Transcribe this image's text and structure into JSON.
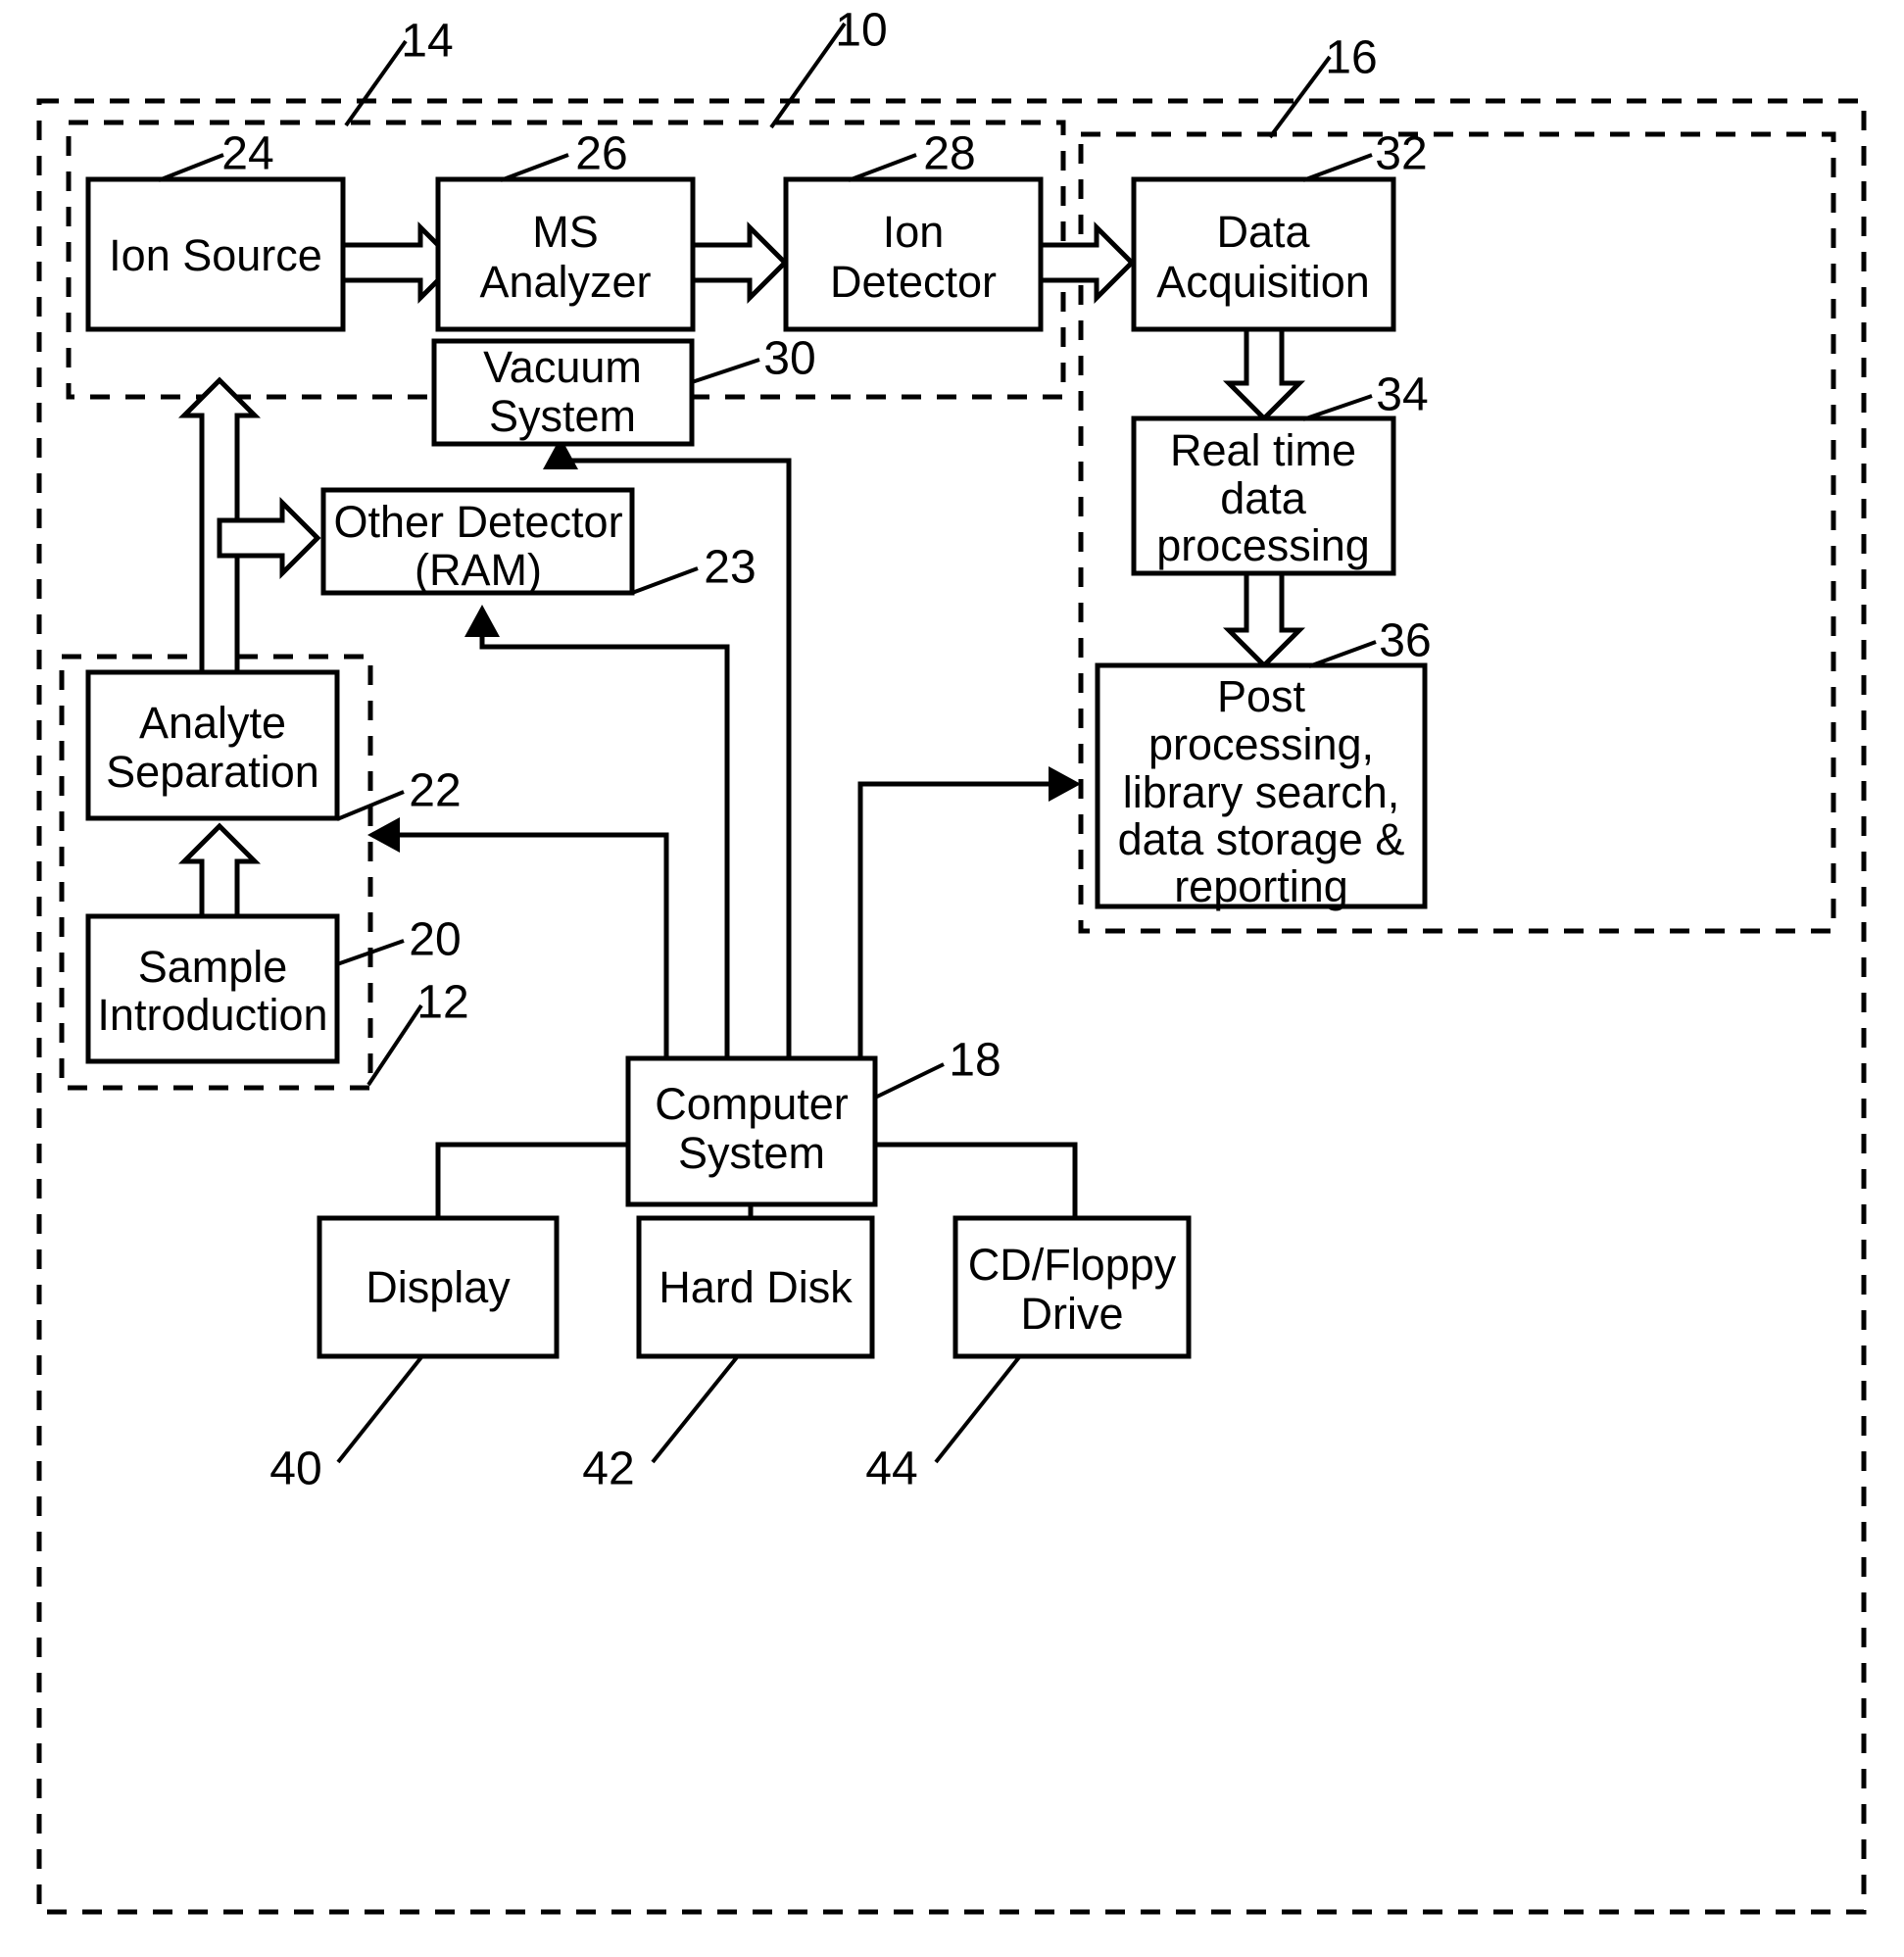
{
  "figure": {
    "kind": "patent-block-diagram",
    "title": "Mass spectrometry system block diagram",
    "ink_color": "#000000",
    "paper_color": "#ffffff"
  },
  "blocks": [
    {
      "id": "ion_source",
      "label_lines": [
        "Ion Source"
      ],
      "ref": "24"
    },
    {
      "id": "ms_analyzer",
      "label_lines": [
        "MS",
        "Analyzer"
      ],
      "ref": "26"
    },
    {
      "id": "ion_detector",
      "label_lines": [
        "Ion",
        "Detector"
      ],
      "ref": "28"
    },
    {
      "id": "data_acquisition",
      "label_lines": [
        "Data",
        "Acquisition"
      ],
      "ref": "32"
    },
    {
      "id": "vacuum_system",
      "label_lines": [
        "Vacuum",
        "System"
      ],
      "ref": "30"
    },
    {
      "id": "real_time",
      "label_lines": [
        "Real time",
        "data",
        "processing"
      ],
      "ref": "34"
    },
    {
      "id": "other_detector",
      "label_lines": [
        "Other Detector",
        "(RAM)"
      ],
      "ref": "23"
    },
    {
      "id": "post_processing",
      "label_lines": [
        "Post",
        "processing,",
        "library search,",
        "data storage &",
        "reporting"
      ],
      "ref": "36"
    },
    {
      "id": "analyte_separation",
      "label_lines": [
        "Analyte",
        "Separation"
      ],
      "ref": "22"
    },
    {
      "id": "sample_introduction",
      "label_lines": [
        "Sample",
        "Introduction"
      ],
      "ref": "20"
    },
    {
      "id": "computer_system",
      "label_lines": [
        "Computer",
        "System"
      ],
      "ref": "18"
    },
    {
      "id": "display",
      "label_lines": [
        "Display"
      ],
      "ref": "40"
    },
    {
      "id": "hard_disk",
      "label_lines": [
        "Hard Disk"
      ],
      "ref": "42"
    },
    {
      "id": "cd_floppy",
      "label_lines": [
        "CD/Floppy",
        "Drive"
      ],
      "ref": "44"
    }
  ],
  "dashed_groups": [
    {
      "id": "system_10",
      "ref": "10"
    },
    {
      "id": "mass_spectrometer_14",
      "ref": "14"
    },
    {
      "id": "data_system_16",
      "ref": "16"
    },
    {
      "id": "inlet_12",
      "ref": "12"
    }
  ],
  "labels": {
    "ion_source": "Ion Source",
    "ms_analyzer_l1": "MS",
    "ms_analyzer_l2": "Analyzer",
    "ion_detector_l1": "Ion",
    "ion_detector_l2": "Detector",
    "data_acquisition_l1": "Data",
    "data_acquisition_l2": "Acquisition",
    "vacuum_system_l1": "Vacuum",
    "vacuum_system_l2": "System",
    "real_time_l1": "Real time",
    "real_time_l2": "data",
    "real_time_l3": "processing",
    "other_detector_l1": "Other Detector",
    "other_detector_l2": "(RAM)",
    "post_l1": "Post",
    "post_l2": "processing,",
    "post_l3": "library search,",
    "post_l4": "data storage &",
    "post_l5": "reporting",
    "analyte_l1": "Analyte",
    "analyte_l2": "Separation",
    "sample_l1": "Sample",
    "sample_l2": "Introduction",
    "computer_l1": "Computer",
    "computer_l2": "System",
    "display": "Display",
    "hard_disk": "Hard Disk",
    "cd_floppy_l1": "CD/Floppy",
    "cd_floppy_l2": "Drive"
  },
  "refs": {
    "r10": "10",
    "r12": "12",
    "r14": "14",
    "r16": "16",
    "r18": "18",
    "r20": "20",
    "r22": "22",
    "r23": "23",
    "r24": "24",
    "r26": "26",
    "r28": "28",
    "r30": "30",
    "r32": "32",
    "r34": "34",
    "r36": "36",
    "r40": "40",
    "r42": "42",
    "r44": "44"
  }
}
